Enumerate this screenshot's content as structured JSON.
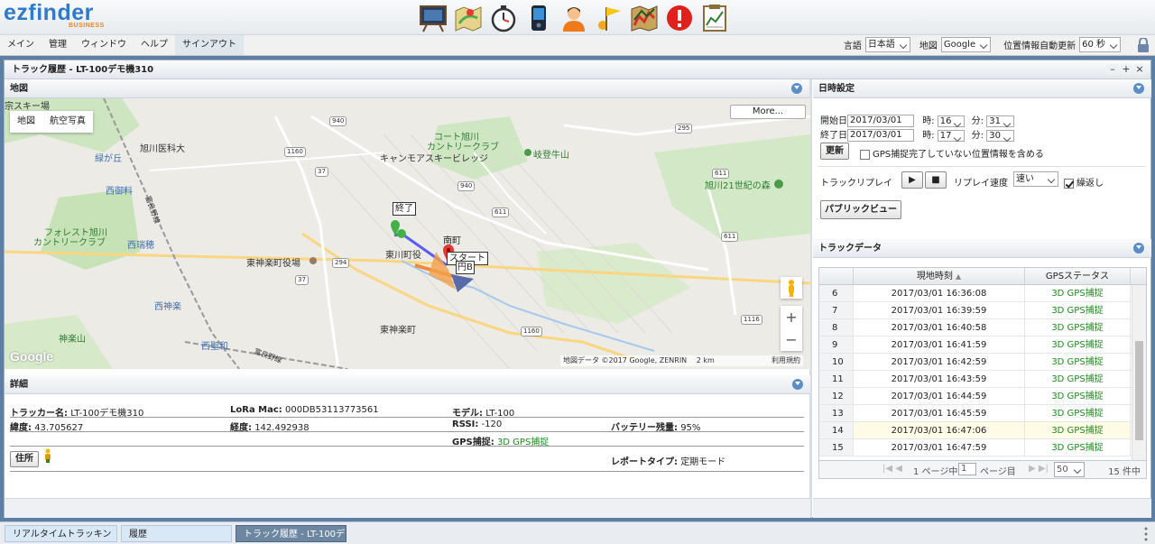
{
  "app": {
    "logo_main": "ezfinder",
    "logo_sub": "BUSINESS"
  },
  "toolbar_icons": [
    "presentation-icon",
    "map-icon",
    "stopwatch-icon",
    "device-icon",
    "user-icon",
    "flag-icon",
    "track-map-icon",
    "alert-icon",
    "report-icon"
  ],
  "menu": {
    "items": [
      "メイン",
      "管理",
      "ウィンドウ",
      "ヘルプ",
      "サインアウト"
    ]
  },
  "prefs": {
    "lang_label": "言語",
    "lang_value": "日本語",
    "map_label": "地図",
    "map_value": "Google",
    "refresh_label": "位置情報自動更新",
    "refresh_value": "60 秒"
  },
  "window": {
    "title": "トラック履歴 - LT-100デモ機310"
  },
  "map_panel": {
    "title": "地図",
    "type_buttons": [
      "地図",
      "航空写真"
    ],
    "more_label": "More...",
    "labels": {
      "l1": "旭川医科大",
      "l2": "コート旭川",
      "l3": "カントリークラブ",
      "l4": "キャンモアスキービレッジ",
      "l5": "岐登牛山",
      "l6": "旭川21世紀の森",
      "l7": "フォレスト旭川",
      "l8": "カントリークラブ",
      "l9": "東神楽町役場",
      "l10": "東川町役",
      "l11": "東神楽町",
      "l12": "神楽山",
      "l13": "緑が丘",
      "l14": "西御料",
      "l15": "西瑞穂",
      "l16": "西神楽",
      "l17": "西聖和",
      "l18": "宗スキー場",
      "l19": "富良野線",
      "l20": "富良野線"
    },
    "road_numbers": [
      "940",
      "295",
      "1160",
      "37",
      "940",
      "611",
      "611",
      "611",
      "294",
      "37",
      "1116",
      "1160"
    ],
    "markers": {
      "end": "終了",
      "start": "スタート",
      "town": "南町",
      "circle": "円B"
    },
    "footer": "地図データ ©2017 Google, ZENRIN　 2 km　 　 　 　 　 　 利用規約",
    "google_logo": "Google"
  },
  "details_panel": {
    "title": "詳細",
    "tracker_label": "トラッカー名:",
    "tracker_value": "LT-100デモ機310",
    "lora_label": "LoRa Mac:",
    "lora_value": "000DB53113773561",
    "model_label": "モデル:",
    "model_value": "LT-100",
    "lat_label": "緯度:",
    "lat_value": "43.705627",
    "lng_label": "経度:",
    "lng_value": "142.492938",
    "rssi_label": "RSSI:",
    "rssi_value": "-120",
    "battery_label": "バッテリー残量:",
    "battery_value": "95%",
    "gps_label": "GPS捕捉:",
    "gps_value": "3D GPS捕捉",
    "address_button": "住所",
    "report_label": "レポートタイプ:",
    "report_value": "定期モード"
  },
  "date_panel": {
    "title": "日時設定",
    "start_label": "開始日",
    "start_date": "2017/03/01",
    "start_hour": "16",
    "start_min": "31",
    "end_label": "終了日",
    "end_date": "2017/03/01",
    "end_hour": "17",
    "end_min": "30",
    "hour_label": "時:",
    "min_label": "分:",
    "update_button": "更新",
    "include_label": "GPS捕捉完了していない位置情報を含める",
    "replay_label": "トラックリプレイ",
    "speed_label": "リプレイ速度",
    "speed_value": "速い",
    "repeat_label": "繰返し",
    "public_button": "パブリックビュー"
  },
  "track_panel": {
    "title": "トラックデータ",
    "col_time": "現地時刻",
    "col_gps": "GPSステータス",
    "rows": [
      {
        "n": "6",
        "time": "2017/03/01 16:36:08",
        "gps": "3D GPS捕捉"
      },
      {
        "n": "7",
        "time": "2017/03/01 16:39:59",
        "gps": "3D GPS捕捉"
      },
      {
        "n": "8",
        "time": "2017/03/01 16:40:58",
        "gps": "3D GPS捕捉"
      },
      {
        "n": "9",
        "time": "2017/03/01 16:41:59",
        "gps": "3D GPS捕捉"
      },
      {
        "n": "10",
        "time": "2017/03/01 16:42:59",
        "gps": "3D GPS捕捉"
      },
      {
        "n": "11",
        "time": "2017/03/01 16:43:59",
        "gps": "3D GPS捕捉"
      },
      {
        "n": "12",
        "time": "2017/03/01 16:44:59",
        "gps": "3D GPS捕捉"
      },
      {
        "n": "13",
        "time": "2017/03/01 16:45:59",
        "gps": "3D GPS捕捉"
      },
      {
        "n": "14",
        "time": "2017/03/01 16:47:06",
        "gps": "3D GPS捕捉"
      },
      {
        "n": "15",
        "time": "2017/03/01 16:47:59",
        "gps": "3D GPS捕捉"
      }
    ],
    "pager_page_prefix": "1 ページ中",
    "pager_page": "1",
    "pager_page_suffix": "ページ目",
    "pager_size": "50",
    "pager_count": "15 件中"
  },
  "taskbar": {
    "tabs": [
      "リアルタイムトラッキン",
      "履歴",
      "トラック履歴 - LT-100デ"
    ]
  }
}
